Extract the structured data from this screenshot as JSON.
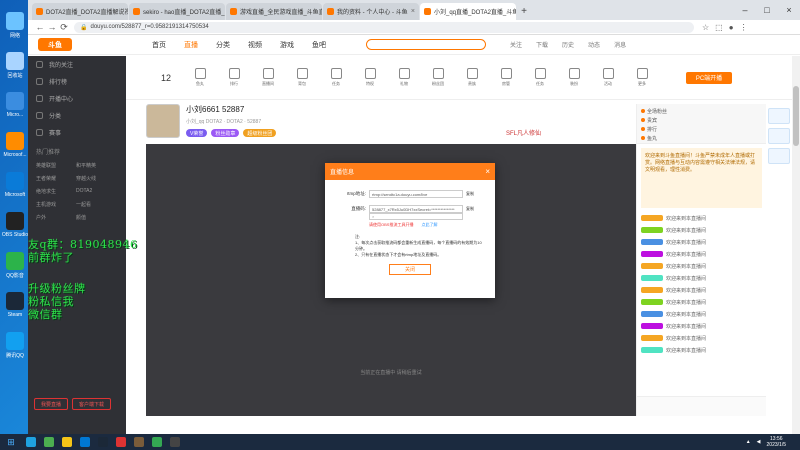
{
  "browser": {
    "tabs": [
      {
        "label": "DOTA2直播_DOTA2直播解说视频",
        "color": "#f70"
      },
      {
        "label": "sekiro - hao直播_DOTA2直播_",
        "color": "#f70"
      },
      {
        "label": "游戏直播_全民游戏直播_斗鱼直",
        "color": "#f70"
      },
      {
        "label": "我的资料 - 个人中心 - 斗鱼",
        "color": "#f70"
      },
      {
        "label": "小刘_qq直播_DOTA2直播_斗鱼",
        "color": "#f70"
      }
    ],
    "url": "douyu.com/528877_r=0.958219131475053​4"
  },
  "desktop_icons": [
    {
      "label": "网络",
      "color": "#6cc3ff"
    },
    {
      "label": "回收站",
      "color": "#a9d4ff"
    },
    {
      "label": "Micro...",
      "color": "#3b8de0"
    },
    {
      "label": "Microsof...",
      "color": "#ff8c00"
    },
    {
      "label": "Microsoft",
      "color": "#0a7bd8"
    },
    {
      "label": "OBS Studio",
      "color": "#222"
    },
    {
      "label": "QQ影音",
      "color": "#2cb34a"
    },
    {
      "label": "Steam",
      "color": "#1b2838"
    },
    {
      "label": "腾讯QQ",
      "color": "#12a0f0"
    }
  ],
  "site": {
    "logo": "斗鱼",
    "nav": [
      "首页",
      "直播",
      "分类",
      "视频",
      "游戏",
      "鱼吧"
    ],
    "tools": [
      "关注",
      "下载",
      "历史",
      "动态",
      "消息"
    ]
  },
  "sidebar": {
    "items": [
      "我的关注",
      "排行榜",
      "开播中心",
      "分类",
      "赛事"
    ],
    "section": "热门推荐",
    "games": [
      "英雄联盟",
      "和平精英",
      "王者荣耀",
      "穿越火线",
      "绝地求生",
      "DOTA2",
      "主机游戏",
      "一起看",
      "户外",
      "颜值"
    ],
    "btn_live": "我要直播",
    "btn_download": "客户端下载"
  },
  "toolbar": {
    "count": "12",
    "items": [
      "鱼丸",
      "排行",
      "直播间",
      "背包",
      "任务",
      "特权",
      "礼物",
      "粉丝团",
      "贵族",
      "房管",
      "任务",
      "装扮",
      "活动",
      "更多"
    ],
    "pc_label": "PC端开播"
  },
  "room": {
    "title": "小刘6661  52887",
    "meta": "小刘_qq   DOTA2 · DOTA2 · 52887",
    "tags": [
      "V荣誉",
      "粉丝勋章",
      "超级粉丝团"
    ],
    "brand": "SFL凡人修仙"
  },
  "modal": {
    "title": "直播信息",
    "rtmp_label": "rtmp地址:",
    "rtmp_value": "rtmp://sendtc1a.douyu.com/live",
    "key_label": "直播码:",
    "key_value": "528877_x7Rx5Ju0DH7xxSecret=***************",
    "copy": "复制",
    "sub_value": "×",
    "tip": "请使用OBS推流工具开播",
    "tip_link": "点此了解",
    "note_title": "注:",
    "note1": "1、每次点击获取推流码都会重新生成直播码，每个直播码的有效期为10分钟。",
    "note2": "2、只有在直播状态下才会有rtmp地址及直播码。",
    "btn": "关闭"
  },
  "player": {
    "footer": "当前正在直播中    请稍后重试"
  },
  "chat": {
    "top": [
      "全场粉丝",
      "贵宾",
      "排行",
      "鱼丸"
    ],
    "notice": "欢迎来到斗鱼直播间！斗鱼严禁未成年人直播或打赏。网络直播与互动内容需遵守相关法律法规，请文明观看，理性消费。",
    "messages": [
      "欢迎来到本直播间",
      "欢迎来到本直播间",
      "欢迎来到本直播间",
      "欢迎来到本直播间",
      "欢迎来到本直播间",
      "欢迎来到本直播间",
      "欢迎来到本直播间",
      "欢迎来到本直播间",
      "欢迎来到本直播间",
      "欢迎来到本直播间",
      "欢迎来到本直播间",
      "欢迎来到本直播间"
    ]
  },
  "overlay": {
    "line1": "友q群：819048946",
    "line2": "前群炸了",
    "line3": "升级粉丝牌",
    "line4": "粉私信我",
    "line5": "微信群"
  },
  "taskbar": {
    "time": "13:56",
    "date": "2023/1/5",
    "apps": [
      {
        "name": "edge",
        "color": "#1fa2e0"
      },
      {
        "name": "chrome",
        "color": "#4caf50"
      },
      {
        "name": "explorer",
        "color": "#f5c518"
      },
      {
        "name": "store",
        "color": "#0078d4"
      },
      {
        "name": "steam",
        "color": "#1b2838"
      },
      {
        "name": "netease",
        "color": "#d33"
      },
      {
        "name": "game",
        "color": "#7a5c3a"
      },
      {
        "name": "chrome2",
        "color": "#34a853"
      },
      {
        "name": "obs",
        "color": "#444"
      }
    ]
  }
}
